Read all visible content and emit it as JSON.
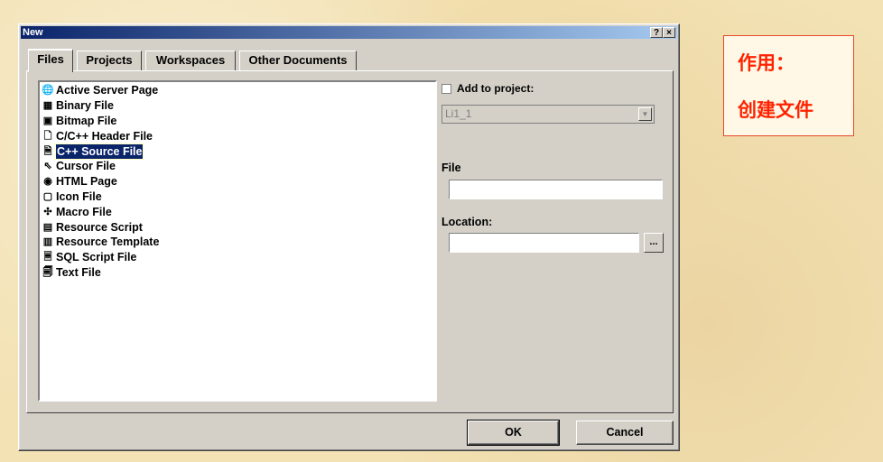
{
  "dialog": {
    "title": "New",
    "help_btn": "?",
    "close_btn": "×"
  },
  "tabs": [
    "Files",
    "Projects",
    "Workspaces",
    "Other Documents"
  ],
  "files": [
    {
      "label": "Active Server Page",
      "icon": "asp-icon"
    },
    {
      "label": "Binary File",
      "icon": "binary-icon"
    },
    {
      "label": "Bitmap File",
      "icon": "bitmap-icon"
    },
    {
      "label": "C/C++ Header File",
      "icon": "header-file-icon"
    },
    {
      "label": "C++ Source File",
      "icon": "source-file-icon",
      "selected": true
    },
    {
      "label": "Cursor File",
      "icon": "cursor-icon"
    },
    {
      "label": "HTML Page",
      "icon": "html-icon"
    },
    {
      "label": "Icon File",
      "icon": "icon-file-icon"
    },
    {
      "label": "Macro File",
      "icon": "macro-icon"
    },
    {
      "label": "Resource Script",
      "icon": "resource-script-icon"
    },
    {
      "label": "Resource Template",
      "icon": "resource-template-icon"
    },
    {
      "label": "SQL Script File",
      "icon": "sql-icon"
    },
    {
      "label": "Text File",
      "icon": "text-file-icon"
    }
  ],
  "right": {
    "add_to_project_label": "Add to project:",
    "project_combo_value": "Li1_1",
    "file_label": "File",
    "file_value": "",
    "location_label": "Location:",
    "location_value": "",
    "browse_label": "..."
  },
  "buttons": {
    "ok": "OK",
    "cancel": "Cancel"
  },
  "note": {
    "line1": "作用：",
    "line2": "创建文件"
  }
}
